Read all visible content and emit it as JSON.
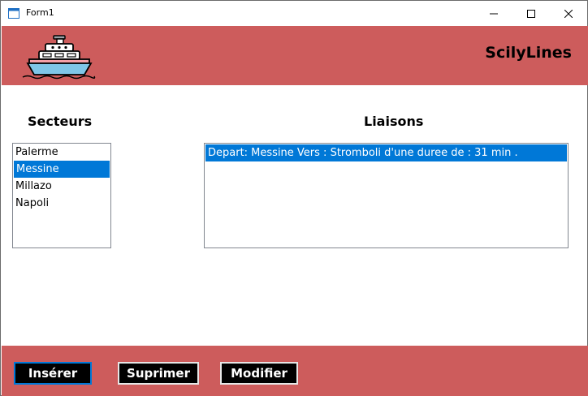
{
  "window": {
    "title": "Form1"
  },
  "header": {
    "brand": "ScilyLines"
  },
  "secteurs": {
    "heading": "Secteurs",
    "items": [
      "Palerme",
      "Messine",
      "Millazo",
      "Napoli"
    ],
    "selected": "Messine"
  },
  "liaisons": {
    "heading": "Liaisons",
    "items": [
      "Depart: Messine Vers : Stromboli d'une duree de : 31 min ."
    ],
    "selected": "Depart: Messine Vers : Stromboli d'une duree de : 31 min ."
  },
  "buttons": {
    "inserer": "Insérer",
    "suprimer": "Suprimer",
    "modifier": "Modifier"
  },
  "icons": {
    "app": "form-icon",
    "logo": "ship-icon",
    "minimize": "minimize-icon",
    "maximize": "maximize-icon",
    "close": "close-icon"
  },
  "colors": {
    "band": "#cd5c5c",
    "selection": "#0078d7",
    "button_bg": "#000000"
  }
}
